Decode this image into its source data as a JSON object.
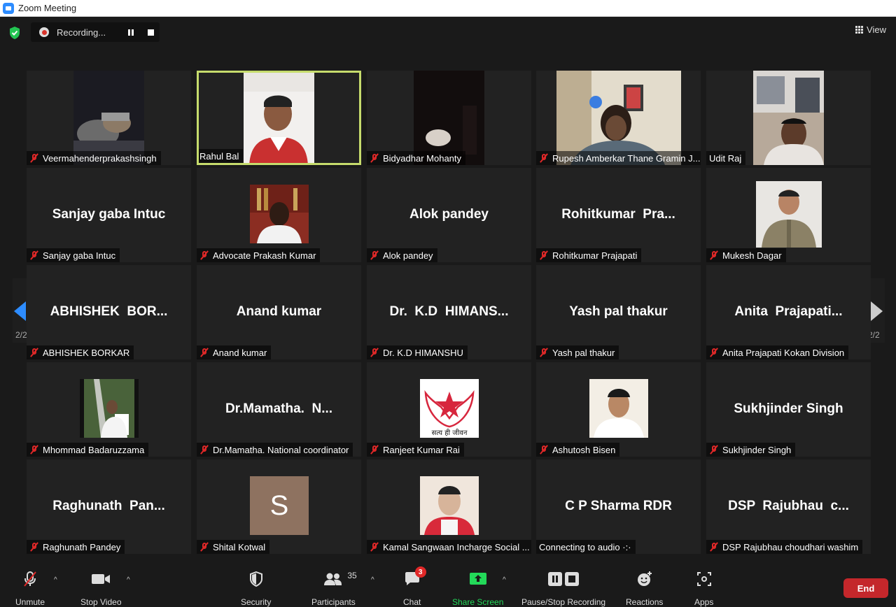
{
  "window": {
    "title": "Zoom Meeting"
  },
  "topbar": {
    "recording_text": "Recording...",
    "view_label": "View"
  },
  "pager": {
    "left": "2/2",
    "right": "2/2"
  },
  "tiles": [
    {
      "big": "",
      "label": "Veermahenderprakashsingh",
      "muted": true
    },
    {
      "big": "",
      "label": "Rahul Bal",
      "muted": false
    },
    {
      "big": "",
      "label": "Bidyadhar Mohanty",
      "muted": true
    },
    {
      "big": "",
      "label": "Rupesh Amberkar Thane Gramin J...",
      "muted": true
    },
    {
      "big": "",
      "label": "Udit Raj",
      "muted": false
    },
    {
      "big": "Sanjay gaba Intuc",
      "label": "Sanjay gaba Intuc",
      "muted": true
    },
    {
      "big": "",
      "label": "Advocate Prakash Kumar",
      "muted": true
    },
    {
      "big": "Alok pandey",
      "label": "Alok pandey",
      "muted": true
    },
    {
      "big": "Rohitkumar  Pra...",
      "label": "Rohitkumar Prajapati",
      "muted": true
    },
    {
      "big": "",
      "label": "Mukesh Dagar",
      "muted": true
    },
    {
      "big": "ABHISHEK  BOR...",
      "label": "ABHISHEK BORKAR",
      "muted": true
    },
    {
      "big": "Anand kumar",
      "label": "Anand kumar",
      "muted": true
    },
    {
      "big": "Dr.  K.D  HIMANS...",
      "label": "Dr. K.D HIMANSHU",
      "muted": true
    },
    {
      "big": "Yash pal thakur",
      "label": "Yash pal thakur",
      "muted": true
    },
    {
      "big": "Anita  Prajapati...",
      "label": "Anita Prajapati Kokan Division",
      "muted": true
    },
    {
      "big": "",
      "label": "Mhommad Badaruzzama",
      "muted": true
    },
    {
      "big": "Dr.Mamatha.  N...",
      "label": "Dr.Mamatha. National coordinator",
      "muted": true
    },
    {
      "big": "",
      "label": "Ranjeet Kumar Rai",
      "muted": true
    },
    {
      "big": "",
      "label": "Ashutosh Bisen",
      "muted": true
    },
    {
      "big": "Sukhjinder Singh",
      "label": "Sukhjinder Singh",
      "muted": true
    },
    {
      "big": "Raghunath  Pan...",
      "label": "Raghunath Pandey",
      "muted": true
    },
    {
      "big": "",
      "label": "Shital Kotwal",
      "muted": true
    },
    {
      "big": "",
      "label": "Kamal Sangwaan Incharge Social ...",
      "muted": true
    },
    {
      "big": "C P Sharma RDR",
      "label": "Connecting to audio ·:·",
      "muted": false
    },
    {
      "big": "DSP  Rajubhau  c...",
      "label": "DSP Rajubhau choudhari washim",
      "muted": true
    }
  ],
  "avatar_letter": "S",
  "logo_caption": "सत्य ही जीवन",
  "toolbar": {
    "unmute": "Unmute",
    "stop_video": "Stop Video",
    "security": "Security",
    "participants": "Participants",
    "participants_count": "35",
    "chat": "Chat",
    "chat_badge": "3",
    "share": "Share Screen",
    "pause_recording": "Pause/Stop Recording",
    "reactions": "Reactions",
    "apps": "Apps",
    "end": "End"
  },
  "colors": {
    "active_speaker": "#c6dc6c",
    "share_green": "#23d959",
    "end_red": "#c4272b",
    "muted_red": "#e02828"
  }
}
